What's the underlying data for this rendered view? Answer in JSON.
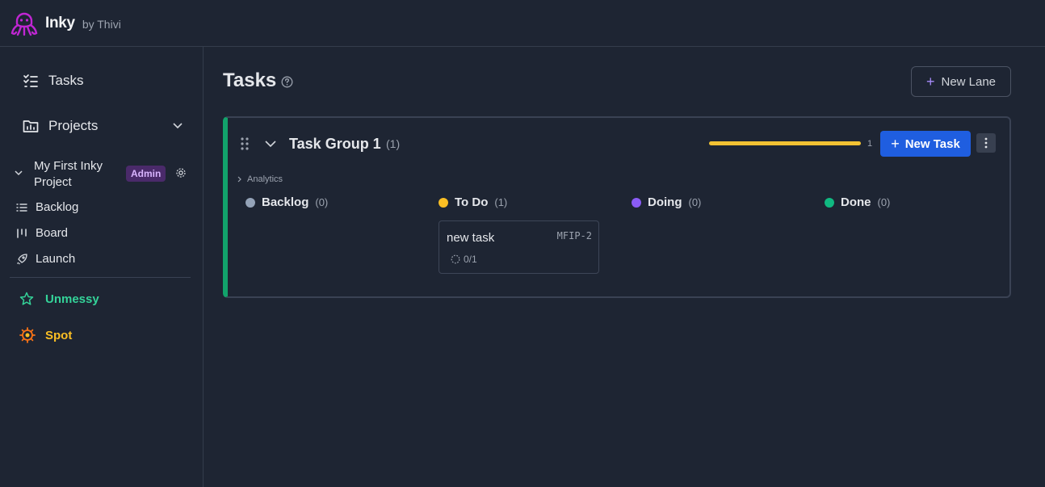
{
  "app": {
    "name": "Inky",
    "by": "by Thivi"
  },
  "colors": {
    "accent": "#1f5ee0",
    "lane": "#12a36b",
    "progress": "#f2c233",
    "logo": "#c026d3"
  },
  "sidebar": {
    "tasks": "Tasks",
    "projects": "Projects",
    "project": {
      "name_line1": "My First Inky",
      "name_line2": "Project",
      "badge": "Admin"
    },
    "items": [
      {
        "label": "Backlog",
        "icon": "list-icon"
      },
      {
        "label": "Board",
        "icon": "board-icon"
      },
      {
        "label": "Launch",
        "icon": "rocket-icon"
      }
    ],
    "apps": [
      {
        "label": "Unmessy",
        "color": "#34d399"
      },
      {
        "label": "Spot",
        "color": "#fbbf24"
      }
    ]
  },
  "main": {
    "title": "Tasks",
    "new_lane": "New Lane",
    "group": {
      "title": "Task Group 1",
      "count": "(1)",
      "progress": 1.0,
      "progress_label": "1",
      "new_task": "New Task",
      "analytics": "Analytics",
      "columns": [
        {
          "name": "Backlog",
          "count": "(0)",
          "color": "#94a3b8"
        },
        {
          "name": "To Do",
          "count": "(1)",
          "color": "#fbbf24"
        },
        {
          "name": "Doing",
          "count": "(0)",
          "color": "#8b5cf6"
        },
        {
          "name": "Done",
          "count": "(0)",
          "color": "#10b981"
        }
      ],
      "card": {
        "title": "new task",
        "id": "MFIP-2",
        "progress": "0/1"
      }
    }
  }
}
